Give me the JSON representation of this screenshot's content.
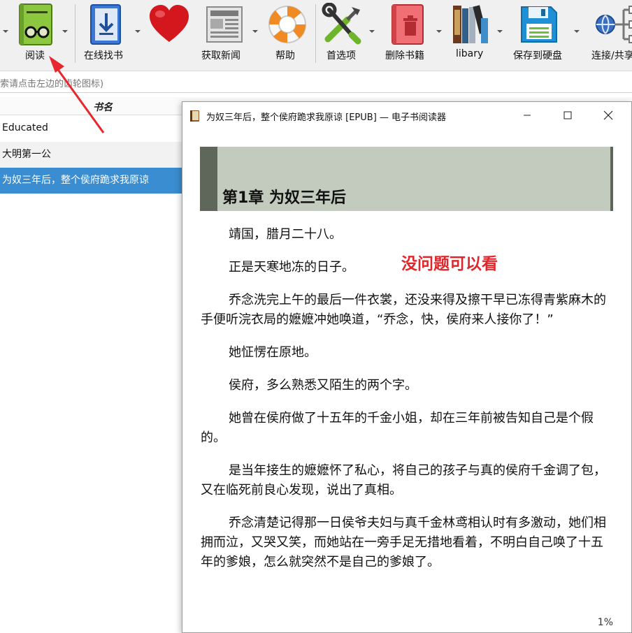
{
  "toolbar": {
    "items": [
      {
        "label": "阅读",
        "icon": "book-glasses-icon"
      },
      {
        "label": "在线找书",
        "icon": "book-download-icon"
      },
      {
        "label": "",
        "icon": "heart-icon"
      },
      {
        "label": "获取新闻",
        "icon": "newspaper-icon"
      },
      {
        "label": "帮助",
        "icon": "lifebuoy-icon"
      },
      {
        "label": "首选项",
        "icon": "tools-icon"
      },
      {
        "label": "删除书籍",
        "icon": "trash-book-icon"
      },
      {
        "label": "libary",
        "icon": "library-books-icon"
      },
      {
        "label": "保存到硬盘",
        "icon": "floppy-disk-icon"
      },
      {
        "label": "连接/共享",
        "icon": "network-icon"
      }
    ]
  },
  "search": {
    "placeholder": "索请点击左边的齿轮图标)"
  },
  "book_list": {
    "header": "书名",
    "rows": [
      {
        "title": "Educated"
      },
      {
        "title": "大明第一公"
      },
      {
        "title": "为奴三年后，整个侯府跪求我原谅"
      }
    ],
    "selected_index": 2
  },
  "reader": {
    "window_title": "为奴三年后，整个侯府跪求我原谅 [EPUB] — 电子书阅读器",
    "chapter_title": "第1章 为奴三年后",
    "paragraphs": [
      "靖国，腊月二十八。",
      "正是天寒地冻的日子。",
      "乔念洗完上午的最后一件衣裳，还没来得及擦干早已冻得青紫麻木的手便听浣衣局的嬷嬷冲她唤道，“乔念，快，侯府来人接你了！”",
      "她怔愣在原地。",
      "侯府，多么熟悉又陌生的两个字。",
      "她曾在侯府做了十五年的千金小姐，却在三年前被告知自己是个假的。",
      "是当年接生的嬷嬷怀了私心，将自己的孩子与真的侯府千金调了包，又在临死前良心发现，说出了真相。",
      "乔念清楚记得那一日侯爷夫妇与真千金林鸢相认时有多激动，她们相拥而泣，又哭又笑，而她站在一旁手足无措地看着，不明白自己唤了十五年的爹娘，怎么就突然不是自己的爹娘了。"
    ],
    "progress": "1%"
  },
  "annotation": {
    "text": "没问题可以看",
    "color": "#e0262b"
  }
}
